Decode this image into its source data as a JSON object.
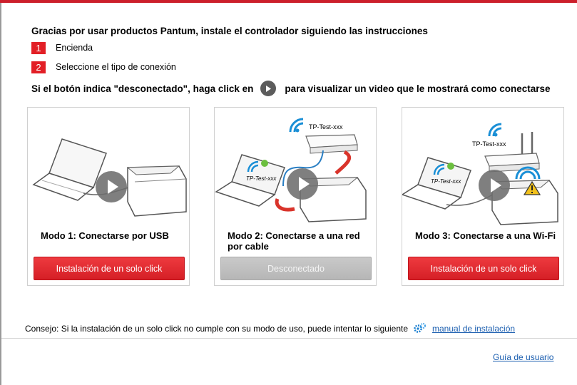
{
  "header": {
    "title": "Gracias por usar productos Pantum, instale el controlador siguiendo las instrucciones",
    "steps": [
      {
        "num": "1",
        "text": "Encienda"
      },
      {
        "num": "2",
        "text": "Seleccione el tipo de conexión"
      }
    ],
    "hint_before": "Si el botón indica \"desconectado\", haga click en",
    "hint_after": "para visualizar un video que le mostrará como conectarse"
  },
  "cards": [
    {
      "mode": "Modo 1: Conectarse por USB",
      "button": "Instalación de un solo click",
      "button_state": "enabled"
    },
    {
      "mode": "Modo 2: Conectarse a una red por cable",
      "button": "Desconectado",
      "button_state": "disabled",
      "router_label": "TP-Test-xxx",
      "laptop_label": "TP-Test-xxx"
    },
    {
      "mode": "Modo 3: Conectarse a una Wi-Fi",
      "button": "Instalación de un solo click",
      "button_state": "enabled",
      "router_label": "TP-Test-xxx",
      "laptop_label": "TP-Test-xxx"
    }
  ],
  "footer": {
    "tip": "Consejo: Si la instalación de un solo click no cumple con su modo de uso, puede intentar lo siguiente",
    "manual_link": "manual de instalación",
    "guide_link": "Guía de usuario"
  },
  "colors": {
    "accent": "#e21f26",
    "link": "#1c5fb0",
    "disabled": "#b9b9b9"
  },
  "icons": [
    "play-icon",
    "gears-icon",
    "wifi-icon",
    "warning-icon",
    "check-icon"
  ]
}
